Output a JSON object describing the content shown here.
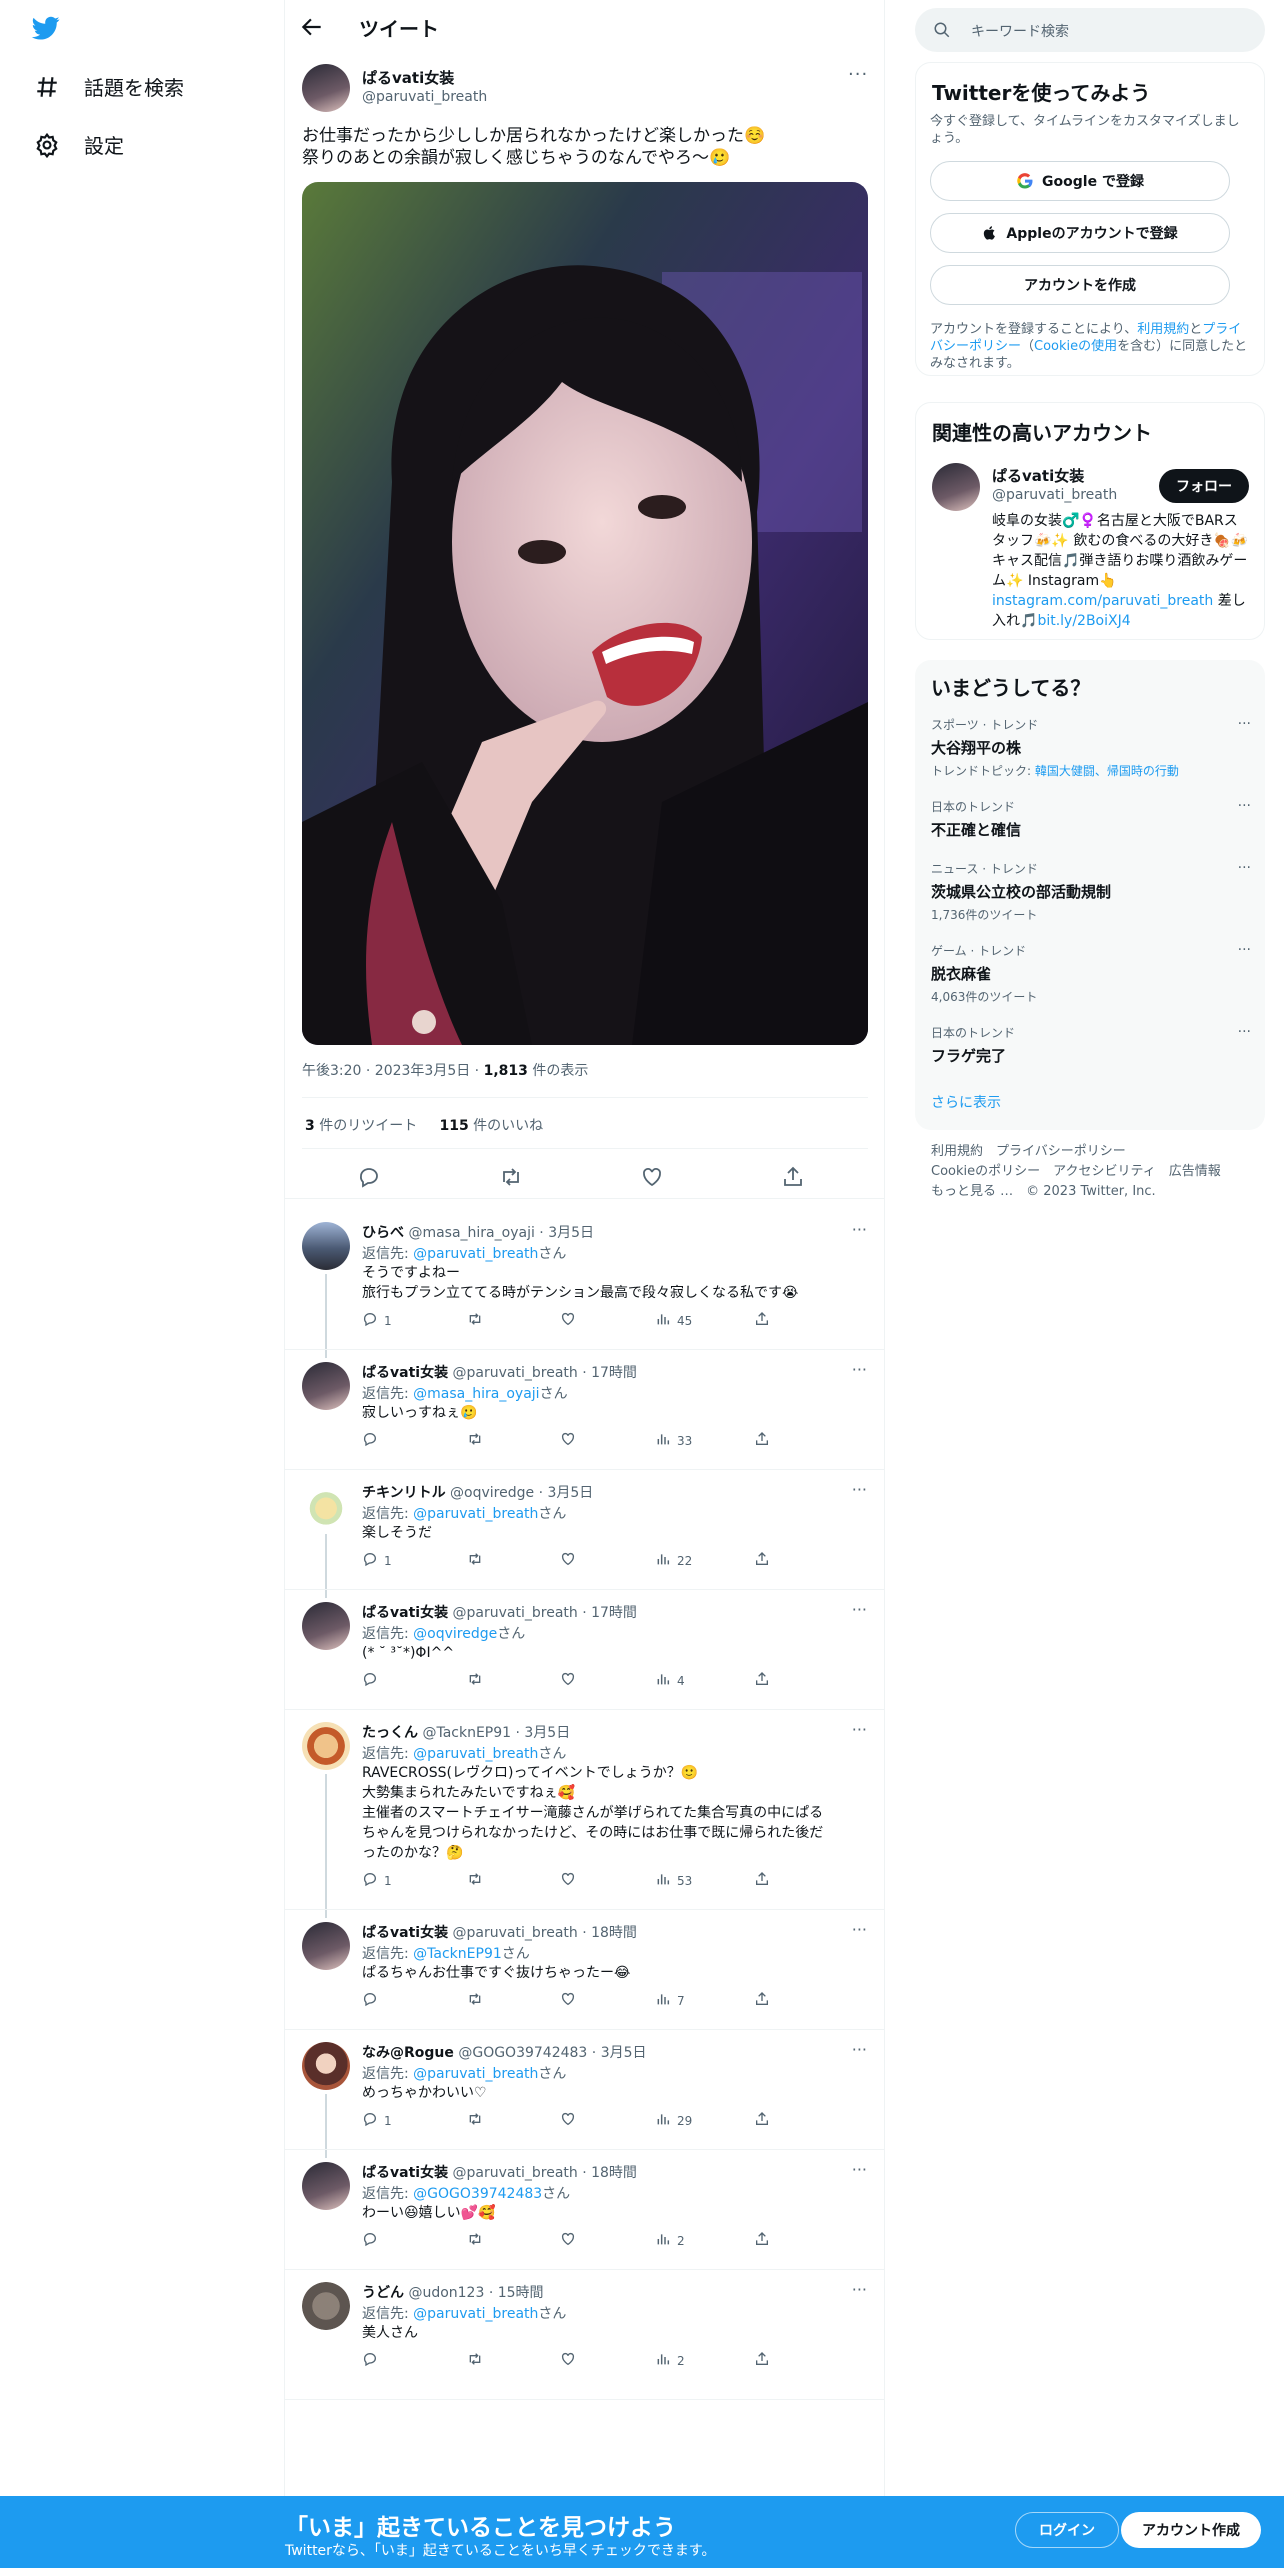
{
  "nav": {
    "explore": "話題を検索",
    "settings": "設定"
  },
  "header": {
    "title": "ツイート"
  },
  "tweet": {
    "name": "ぱるvati女装",
    "handle": "@paruvati_breath",
    "text_line1": "お仕事だったから少ししか居られなかったけど楽しかった☺️",
    "text_line2": "祭りのあとの余韻が寂しく感じちゃうのなんでやろ〜🥲",
    "time": "午後3:20 · 2023年3月5日 · ",
    "views": "1,813",
    "views_suffix": " 件の表示",
    "retweets": "3",
    "retweets_label": " 件のリツイート",
    "likes": "115",
    "likes_label": " 件のいいね"
  },
  "replies": [
    {
      "name": "ひらべ",
      "handle": "@masa_hira_oyaji",
      "time": " · 3月5日",
      "to_prefix": "返信先: ",
      "to": "@paruvati_breath",
      "to_suffix": "さん",
      "lines": [
        "そうですよねー",
        "旅行もプラン立ててる時がテンション最高で段々寂しくなる私です😭"
      ],
      "replies": "1",
      "retweets": "",
      "likes": "",
      "views": "45"
    },
    {
      "name": "ぱるvati女装",
      "handle": "@paruvati_breath",
      "time": " · 17時間",
      "to_prefix": "返信先: ",
      "to": "@masa_hira_oyaji",
      "to_suffix": "さん",
      "lines": [
        "寂しいっすねぇ🥲"
      ],
      "replies": "",
      "retweets": "",
      "likes": "",
      "views": "33"
    },
    {
      "name": "チキンリトル",
      "handle": "@oqviredge",
      "time": " · 3月5日",
      "to_prefix": "返信先: ",
      "to": "@paruvati_breath",
      "to_suffix": "さん",
      "lines": [
        "楽しそうだ"
      ],
      "replies": "1",
      "retweets": "",
      "likes": "",
      "views": "22"
    },
    {
      "name": "ぱるvati女装",
      "handle": "@paruvati_breath",
      "time": " · 17時間",
      "to_prefix": "返信先: ",
      "to": "@oqviredge",
      "to_suffix": "さん",
      "lines": [
        "(* ˘ ³˘*)ΦI^^"
      ],
      "replies": "",
      "retweets": "",
      "likes": "",
      "views": "4"
    },
    {
      "name": "たっくん",
      "handle": "@TacknEP91",
      "time": " · 3月5日",
      "to_prefix": "返信先: ",
      "to": "@paruvati_breath",
      "to_suffix": "さん",
      "lines": [
        "RAVECROSS(レヴクロ)ってイベントでしょうか？🙂",
        "大勢集まられたみたいですねぇ🥰",
        "主催者のスマートチェイサー滝藤さんが挙げられてた集合写真の中にぱる",
        "ちゃんを見つけられなかったけど、その時にはお仕事で既に帰られた後だ",
        "ったのかな？🤔"
      ],
      "replies": "1",
      "retweets": "",
      "likes": "",
      "views": "53"
    },
    {
      "name": "ぱるvati女装",
      "handle": "@paruvati_breath",
      "time": " · 18時間",
      "to_prefix": "返信先: ",
      "to": "@TacknEP91",
      "to_suffix": "さん",
      "lines": [
        "ぱるちゃんお仕事ですぐ抜けちゃったー😂"
      ],
      "replies": "",
      "retweets": "",
      "likes": "",
      "views": "7"
    },
    {
      "name": "なみ@Rogue",
      "handle": "@GOGO39742483",
      "time": " · 3月5日",
      "to_prefix": "返信先: ",
      "to": "@paruvati_breath",
      "to_suffix": "さん",
      "lines": [
        "めっちゃかわいい♡"
      ],
      "replies": "1",
      "retweets": "",
      "likes": "",
      "views": "29"
    },
    {
      "name": "ぱるvati女装",
      "handle": "@paruvati_breath",
      "time": " · 18時間",
      "to_prefix": "返信先: ",
      "to": "@GOGO39742483",
      "to_suffix": "さん",
      "lines": [
        "わーい😆嬉しい💕🥰"
      ],
      "replies": "",
      "retweets": "",
      "likes": "",
      "views": "2"
    },
    {
      "name": "うどん",
      "handle": "@udon123",
      "time": " · 15時間",
      "to_prefix": "返信先: ",
      "to": "@paruvati_breath",
      "to_suffix": "さん",
      "lines": [
        "美人さん"
      ],
      "replies": "",
      "retweets": "",
      "likes": "",
      "views": "2"
    }
  ],
  "right": {
    "search_placeholder": "キーワード検索",
    "signup": {
      "title": "Twitterを使ってみよう",
      "desc": "今すぐ登録して、タイムラインをカスタマイズしましょう。",
      "google": "Google で登録",
      "apple": "Appleのアカウントで登録",
      "create": "アカウントを作成",
      "terms1": "アカウントを登録することにより、",
      "terms_link1": "利用規約",
      "terms2": "と",
      "terms_link2": "プライバシーポリシー",
      "terms3": "（",
      "terms_link3": "Cookieの使用",
      "terms4": "を含む）に同意したとみなされます。"
    },
    "related": {
      "title": "関連性の高いアカウント",
      "name": "ぱるvati女装",
      "handle": "@paruvati_breath",
      "follow": "フォロー",
      "bio1": "岐阜の女装♂️♀️名古屋と大阪でBARスタッフ🍻✨ 飲むの食べるの大好き🍖🍻 キャス配信🎵弾き語りお喋り酒飲みゲーム✨ Instagram👆",
      "bio_link": "instagram.com/paruvati_breath",
      "bio2": " 差し入れ🎵",
      "bio_link2": "bit.ly/2BoiXJ4"
    },
    "trends": {
      "title": "いまどうしてる？",
      "items": [
        {
          "cat": "スポーツ · トレンド",
          "name": "大谷翔平の株",
          "sub_prefix": "トレンドトピック: ",
          "sub": "韓国大健闘、帰国時の行動"
        },
        {
          "cat": "日本のトレンド",
          "name": "不正確と確信",
          "sub_prefix": "",
          "sub": ""
        },
        {
          "cat": "ニュース · トレンド",
          "name": "茨城県公立校の部活動規制",
          "sub_prefix": "1,736件のツイート",
          "sub": ""
        },
        {
          "cat": "ゲーム · トレンド",
          "name": "脱衣麻雀",
          "sub_prefix": "4,063件のツイート",
          "sub": ""
        },
        {
          "cat": "日本のトレンド",
          "name": "フラゲ完了",
          "sub_prefix": "",
          "sub": ""
        }
      ],
      "show_more": "さらに表示"
    },
    "footer": {
      "line1": "利用規約　プライバシーポリシー",
      "line2": "Cookieのポリシー　アクセシビリティ　広告情報",
      "line3": "もっと見る …　© 2023 Twitter, Inc."
    }
  },
  "bottom": {
    "title": "「いま」起きていることを見つけよう",
    "sub": "Twitterなら、「いま」起きていることをいち早くチェックできます。",
    "login": "ログイン",
    "signup": "アカウント作成"
  },
  "colors": {
    "accent": "#1d9bf0",
    "text": "#0f1419",
    "muted": "#536471"
  }
}
